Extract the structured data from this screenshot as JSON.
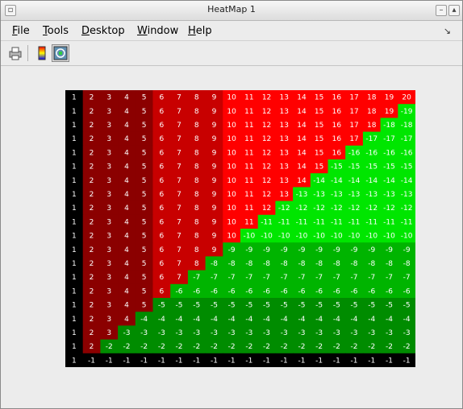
{
  "window": {
    "title": "HeatMap 1"
  },
  "menu": {
    "items": [
      {
        "label": "File",
        "underline": "F",
        "rest": "ile"
      },
      {
        "label": "Tools",
        "underline": "T",
        "rest": "ools"
      },
      {
        "label": "Desktop",
        "underline": "D",
        "rest": "esktop"
      },
      {
        "label": "Window",
        "underline": "W",
        "rest": "indow"
      },
      {
        "label": "Help",
        "underline": "H",
        "rest": "elp"
      }
    ]
  },
  "toolbar": {
    "tools": [
      {
        "icon": "print-icon"
      },
      {
        "icon": "colorbar-icon"
      },
      {
        "icon": "rotate-icon",
        "selected": true
      }
    ]
  },
  "chart_data": {
    "type": "heatmap",
    "rows": 20,
    "cols": 20,
    "row_rule": "each row r (0-19): columns 0..(19-r) show column index+1 when less than or equal to 20-r; remaining columns show -(20-r)",
    "values": [
      [
        1,
        2,
        3,
        4,
        5,
        6,
        7,
        8,
        9,
        10,
        11,
        12,
        13,
        14,
        15,
        16,
        17,
        18,
        19,
        20
      ],
      [
        1,
        2,
        3,
        4,
        5,
        6,
        7,
        8,
        9,
        10,
        11,
        12,
        13,
        14,
        15,
        16,
        17,
        18,
        19,
        -19
      ],
      [
        1,
        2,
        3,
        4,
        5,
        6,
        7,
        8,
        9,
        10,
        11,
        12,
        13,
        14,
        15,
        16,
        17,
        18,
        -18,
        -18
      ],
      [
        1,
        2,
        3,
        4,
        5,
        6,
        7,
        8,
        9,
        10,
        11,
        12,
        13,
        14,
        15,
        16,
        17,
        -17,
        -17,
        -17
      ],
      [
        1,
        2,
        3,
        4,
        5,
        6,
        7,
        8,
        9,
        10,
        11,
        12,
        13,
        14,
        15,
        16,
        -16,
        -16,
        -16,
        -16
      ],
      [
        1,
        2,
        3,
        4,
        5,
        6,
        7,
        8,
        9,
        10,
        11,
        12,
        13,
        14,
        15,
        -15,
        -15,
        -15,
        -15,
        -15
      ],
      [
        1,
        2,
        3,
        4,
        5,
        6,
        7,
        8,
        9,
        10,
        11,
        12,
        13,
        14,
        -14,
        -14,
        -14,
        -14,
        -14,
        -14
      ],
      [
        1,
        2,
        3,
        4,
        5,
        6,
        7,
        8,
        9,
        10,
        11,
        12,
        13,
        -13,
        -13,
        -13,
        -13,
        -13,
        -13,
        -13
      ],
      [
        1,
        2,
        3,
        4,
        5,
        6,
        7,
        8,
        9,
        10,
        11,
        12,
        -12,
        -12,
        -12,
        -12,
        -12,
        -12,
        -12,
        -12
      ],
      [
        1,
        2,
        3,
        4,
        5,
        6,
        7,
        8,
        9,
        10,
        11,
        -11,
        -11,
        -11,
        -11,
        -11,
        -11,
        -11,
        -11,
        -11
      ],
      [
        1,
        2,
        3,
        4,
        5,
        6,
        7,
        8,
        9,
        10,
        -10,
        -10,
        -10,
        -10,
        -10,
        -10,
        -10,
        -10,
        -10,
        -10
      ],
      [
        1,
        2,
        3,
        4,
        5,
        6,
        7,
        8,
        9,
        -9,
        -9,
        -9,
        -9,
        -9,
        -9,
        -9,
        -9,
        -9,
        -9,
        -9
      ],
      [
        1,
        2,
        3,
        4,
        5,
        6,
        7,
        8,
        -8,
        -8,
        -8,
        -8,
        -8,
        -8,
        -8,
        -8,
        -8,
        -8,
        -8,
        -8
      ],
      [
        1,
        2,
        3,
        4,
        5,
        6,
        7,
        -7,
        -7,
        -7,
        -7,
        -7,
        -7,
        -7,
        -7,
        -7,
        -7,
        -7,
        -7,
        -7
      ],
      [
        1,
        2,
        3,
        4,
        5,
        6,
        -6,
        -6,
        -6,
        -6,
        -6,
        -6,
        -6,
        -6,
        -6,
        -6,
        -6,
        -6,
        -6,
        -6
      ],
      [
        1,
        2,
        3,
        4,
        5,
        -5,
        -5,
        -5,
        -5,
        -5,
        -5,
        -5,
        -5,
        -5,
        -5,
        -5,
        -5,
        -5,
        -5,
        -5
      ],
      [
        1,
        2,
        3,
        4,
        -4,
        -4,
        -4,
        -4,
        -4,
        -4,
        -4,
        -4,
        -4,
        -4,
        -4,
        -4,
        -4,
        -4,
        -4,
        -4
      ],
      [
        1,
        2,
        3,
        -3,
        -3,
        -3,
        -3,
        -3,
        -3,
        -3,
        -3,
        -3,
        -3,
        -3,
        -3,
        -3,
        -3,
        -3,
        -3,
        -3
      ],
      [
        1,
        2,
        -2,
        -2,
        -2,
        -2,
        -2,
        -2,
        -2,
        -2,
        -2,
        -2,
        -2,
        -2,
        -2,
        -2,
        -2,
        -2,
        -2,
        -2
      ],
      [
        1,
        -1,
        -1,
        -1,
        -1,
        -1,
        -1,
        -1,
        -1,
        -1,
        -1,
        -1,
        -1,
        -1,
        -1,
        -1,
        -1,
        -1,
        -1,
        -1
      ]
    ],
    "colormap": {
      "positive_dark": "#8b0000",
      "positive_mid": "#c80000",
      "positive_bright": "#ff0000",
      "negative_bright": "#00e600",
      "negative_mid": "#00b400",
      "negative_dark": "#008c00",
      "one_and_minus_one": "#000000",
      "text": "#ffffff"
    }
  }
}
